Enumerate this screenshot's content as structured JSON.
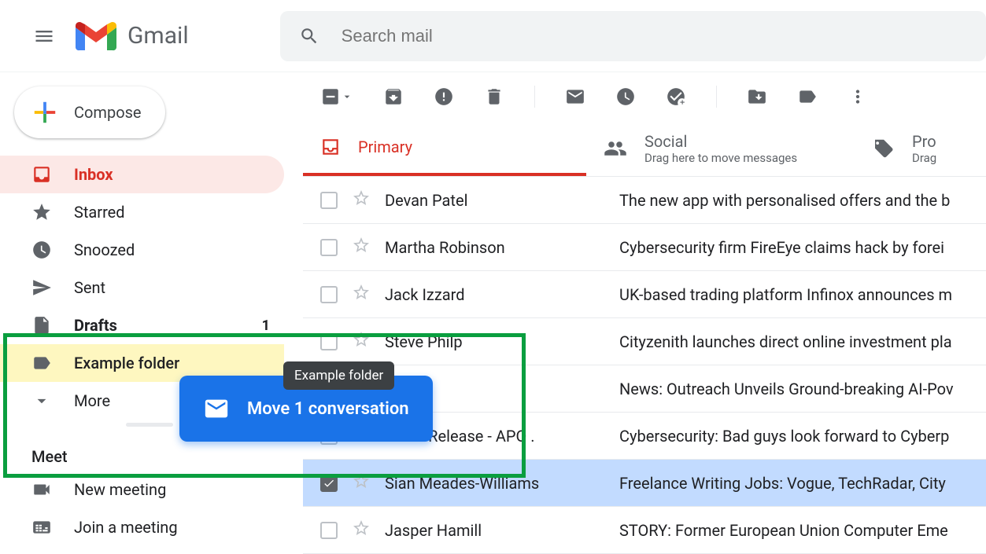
{
  "app_name": "Gmail",
  "search": {
    "placeholder": "Search mail"
  },
  "compose_label": "Compose",
  "sidebar": {
    "inbox": "Inbox",
    "starred": "Starred",
    "snoozed": "Snoozed",
    "sent": "Sent",
    "drafts": "Drafts",
    "drafts_count": "1",
    "example_folder": "Example folder",
    "more": "More"
  },
  "meet": {
    "header": "Meet",
    "new_meeting": "New meeting",
    "join_meeting": "Join a meeting"
  },
  "tabs": {
    "primary": "Primary",
    "social": {
      "title": "Social",
      "sub": "Drag here to move messages"
    },
    "promotions": {
      "title": "Pro",
      "sub": "Drag"
    }
  },
  "move_overlay": {
    "tooltip": "Example folder",
    "text": "Move 1 conversation"
  },
  "emails": [
    {
      "sender": "Devan Patel",
      "subject": "The new app with personalised offers and the b",
      "checked": false
    },
    {
      "sender": "Martha Robinson",
      "subject": "Cybersecurity firm FireEye claims hack by forei",
      "checked": false
    },
    {
      "sender": "Jack Izzard",
      "subject": "UK-based trading platform Infinox announces m",
      "checked": false
    },
    {
      "sender": "Steve Philp",
      "subject": "Cityzenith launches direct online investment pla",
      "checked": false
    },
    {
      "sender": "",
      "subject": "News: Outreach Unveils Ground-breaking AI-Pov",
      "checked": false
    },
    {
      "sender": "News Release - APO .",
      "subject": "Cybersecurity: Bad guys look forward to Cyberp",
      "checked": false
    },
    {
      "sender": "Sian Meades-Williams",
      "subject": "Freelance Writing Jobs: Vogue, TechRadar, City",
      "checked": true
    },
    {
      "sender": "Jasper Hamill",
      "subject": "STORY: Former European Union Computer Eme",
      "checked": false
    }
  ]
}
